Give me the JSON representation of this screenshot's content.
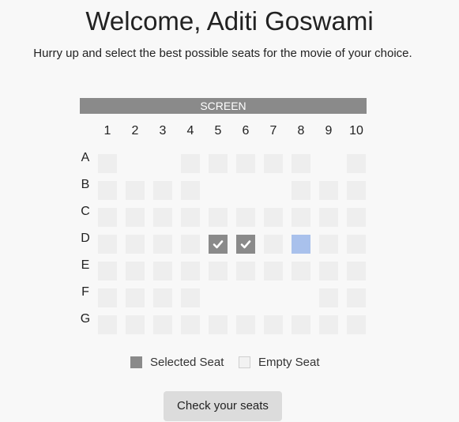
{
  "header": {
    "title": "Welcome, Aditi Goswami",
    "subtitle": "Hurry up and select the best possible seats for the movie of your choice."
  },
  "screen_label": "SCREEN",
  "columns": [
    "1",
    "2",
    "3",
    "4",
    "5",
    "6",
    "7",
    "8",
    "9",
    "10"
  ],
  "rows": [
    {
      "label": "A",
      "seats": [
        "empty",
        "none",
        "none",
        "empty",
        "empty",
        "empty",
        "empty",
        "empty",
        "none",
        "empty"
      ]
    },
    {
      "label": "B",
      "seats": [
        "empty",
        "empty",
        "empty",
        "empty",
        "none",
        "none",
        "none",
        "empty",
        "empty",
        "empty"
      ]
    },
    {
      "label": "C",
      "seats": [
        "empty",
        "empty",
        "empty",
        "empty",
        "empty",
        "empty",
        "empty",
        "empty",
        "empty",
        "empty"
      ]
    },
    {
      "label": "D",
      "seats": [
        "empty",
        "empty",
        "empty",
        "empty",
        "selected",
        "selected",
        "empty",
        "reserved",
        "empty",
        "empty"
      ]
    },
    {
      "label": "E",
      "seats": [
        "empty",
        "empty",
        "empty",
        "empty",
        "empty",
        "empty",
        "empty",
        "empty",
        "empty",
        "empty"
      ]
    },
    {
      "label": "F",
      "seats": [
        "empty",
        "empty",
        "empty",
        "empty",
        "none",
        "none",
        "none",
        "none",
        "empty",
        "empty"
      ]
    },
    {
      "label": "G",
      "seats": [
        "empty",
        "empty",
        "empty",
        "empty",
        "empty",
        "empty",
        "empty",
        "empty",
        "empty",
        "empty"
      ]
    }
  ],
  "legend": {
    "selected_label": "Selected Seat",
    "empty_label": "Empty Seat"
  },
  "check_button_label": "Check your seats",
  "colors": {
    "screen": "#8a8a8a",
    "empty_seat": "#eeeeee",
    "selected_seat": "#8a8a8a",
    "reserved_seat": "#a9c1ec",
    "button": "#dcdcdc"
  },
  "icons": {
    "selected_seat_mark": "checkmark-icon"
  }
}
